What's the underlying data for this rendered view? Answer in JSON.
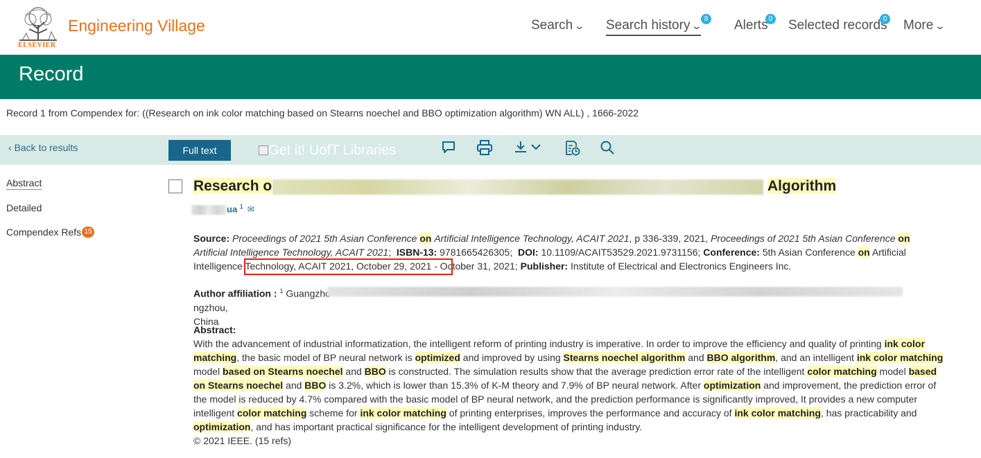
{
  "header": {
    "brand": "Engineering Village",
    "logo_text": "ELSEVIER",
    "nav": [
      {
        "label": "Search",
        "chevron": true,
        "badge": null
      },
      {
        "label": "Search history",
        "chevron": true,
        "badge": "8"
      },
      {
        "label": "Alerts",
        "chevron": false,
        "badge": "0"
      },
      {
        "label": "Selected records",
        "chevron": false,
        "badge": "0"
      },
      {
        "label": "More",
        "chevron": true,
        "badge": null
      }
    ]
  },
  "record_bar": {
    "title": "Record"
  },
  "query_text": "Record 1 from Compendex for: ((Research on ink color matching based on Stearns noechel and BBO optimization algorithm) WN ALL) , 1666-2022",
  "toolbar": {
    "back_label": "Back to results",
    "full_text_label": "Full text",
    "getit_alt": "Get it! UofT Libraries",
    "icons": [
      "comment-icon",
      "print-icon",
      "download-icon",
      "save-to-folder-icon",
      "search-icon"
    ]
  },
  "sidebar": {
    "items": [
      {
        "label": "Abstract",
        "active": true
      },
      {
        "label": "Detailed",
        "active": false
      },
      {
        "label": "Compendex Refs",
        "active": false,
        "badge": "15"
      }
    ]
  },
  "record": {
    "title_start": "Research o",
    "title_end": "Algorithm",
    "author_visible": "ua",
    "author_sup": "1",
    "source": {
      "label": "Source:",
      "seg1": "Proceedings of 2021 5th Asian Conference",
      "on": "on",
      "seg2": "Artificial Intelligence Technology, ACAIT 2021",
      "seg3": ", p 336-339, 2021,",
      "seg4": "Proceedings of 2021 5th Asian Conference",
      "seg5": "Artificial Intelligence Technology, ACAIT 2021",
      "isbn_label": "ISBN-13:",
      "isbn": "9781665426305",
      "doi_label": "DOI:",
      "doi": "10.1109/ACAIT53529.2021.9731156",
      "conf_label": "Conference:",
      "conf1": "5th Asian Conference",
      "conf2": "Artificial Intelligence Technology, ACAIT 2021, October 29, 2021 - October 31, 2021",
      "pub_label": "Publisher:",
      "publisher": "Institute of Electrical and Electronics Engineers Inc."
    },
    "affiliation": {
      "label": "Author affiliation :",
      "sup": "1",
      "start": "Guangzho",
      "end": "ngzhou,",
      "country": "China"
    },
    "abstract": {
      "label": "Abstract:",
      "copyright": "© 2021 IEEE. (15 refs)"
    }
  },
  "colors": {
    "brand_orange": "#e9711c",
    "record_bar": "#007b67",
    "toolbar_bg": "#d7eae6",
    "button_blue": "#18668a",
    "badge_blue": "#2fb0e3",
    "highlight": "#fffbb8",
    "annotation_red": "#e0201e"
  }
}
